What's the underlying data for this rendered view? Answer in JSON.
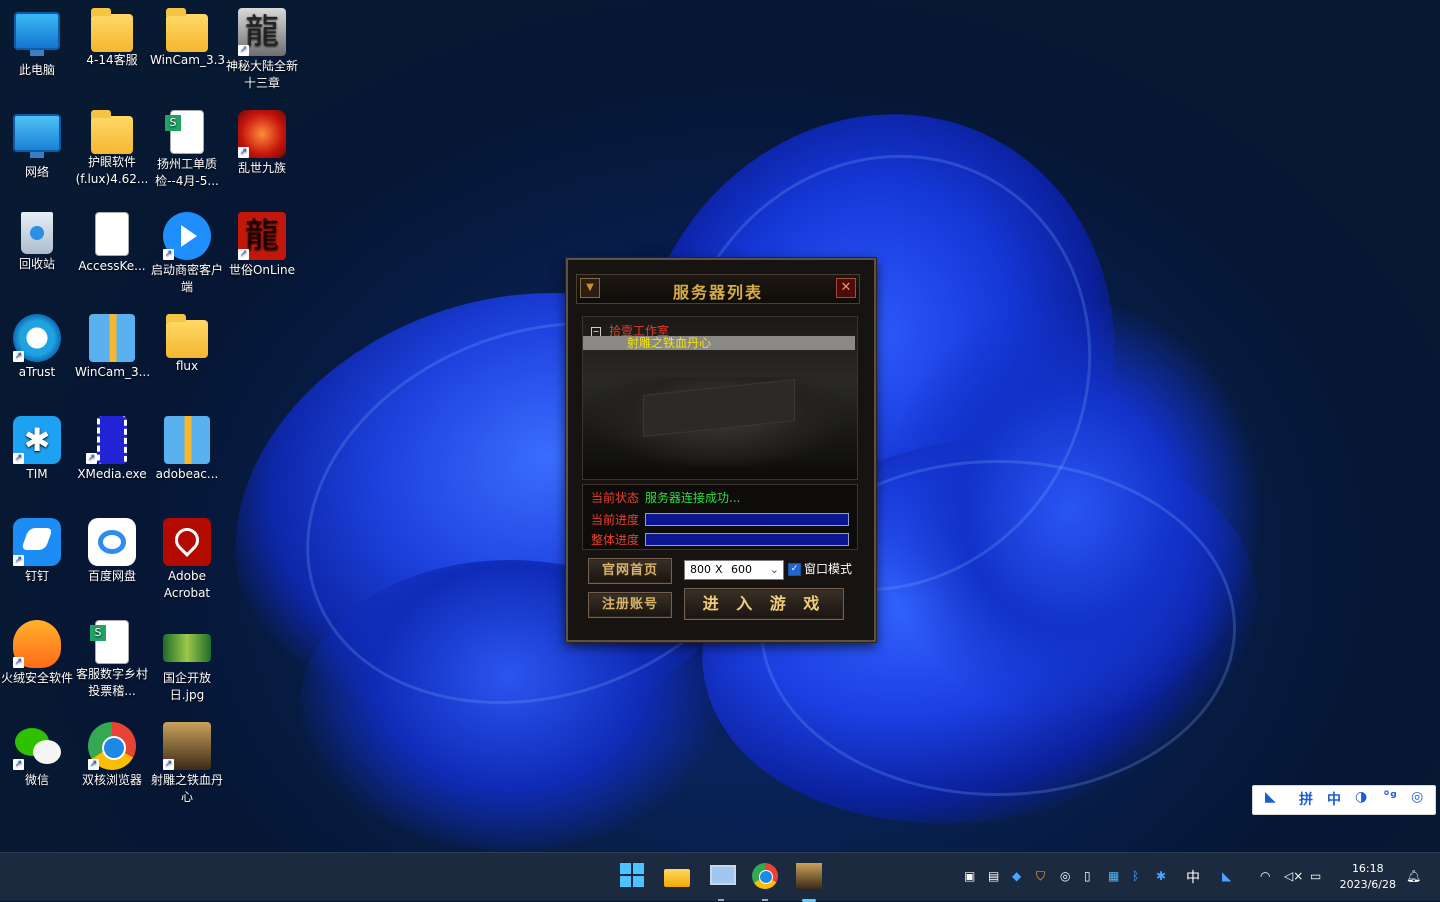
{
  "desktop": {
    "icons": [
      {
        "label": "此电脑"
      },
      {
        "label": "4-14客服"
      },
      {
        "label": "WinCam_3.3"
      },
      {
        "label": "神秘大陆全新十三章"
      },
      {
        "label": "网络"
      },
      {
        "label": "护眼软件(f.lux)4.62..."
      },
      {
        "label": "扬州工单质检--4月-5..."
      },
      {
        "label": "乱世九族"
      },
      {
        "label": "回收站"
      },
      {
        "label": "AccessKe..."
      },
      {
        "label": "启动商密客户端"
      },
      {
        "label": "世俗OnLine"
      },
      {
        "label": "aTrust"
      },
      {
        "label": "WinCam_3..."
      },
      {
        "label": "flux"
      },
      {
        "label": "TIM"
      },
      {
        "label": "XMedia.exe"
      },
      {
        "label": "adobeac..."
      },
      {
        "label": "钉钉"
      },
      {
        "label": "百度网盘"
      },
      {
        "label": "Adobe Acrobat"
      },
      {
        "label": "火绒安全软件"
      },
      {
        "label": "客服数字乡村投票稽..."
      },
      {
        "label": "国企开放日.jpg"
      },
      {
        "label": "微信"
      },
      {
        "label": "双核浏览器"
      },
      {
        "label": "射雕之铁血丹心"
      }
    ]
  },
  "dialog": {
    "title": "服务器列表",
    "tree_group": "拾壹工作室",
    "tree_server": "射雕之铁血丹心",
    "status_label": "当前状态",
    "status_value": "服务器连接成功...",
    "progress_current_label": "当前进度",
    "progress_total_label": "整体进度",
    "progress_current": 1.0,
    "progress_total": 1.0,
    "homepage_button": "官网首页",
    "register_button": "注册账号",
    "enter_button": "进 入 游 戏",
    "resolution_width": "800",
    "resolution_x": "X",
    "resolution_height": "600",
    "window_mode_label": "窗口模式",
    "window_mode_checked": true
  },
  "ime": {
    "items": [
      "拼",
      "中"
    ]
  },
  "taskbar": {
    "pinned": [
      "start-icon",
      "file-explorer-icon",
      "remote-desktop-icon",
      "browser-icon",
      "game-icon"
    ],
    "tray_lang": "中",
    "time": "16:18",
    "date": "2023/6/28"
  }
}
